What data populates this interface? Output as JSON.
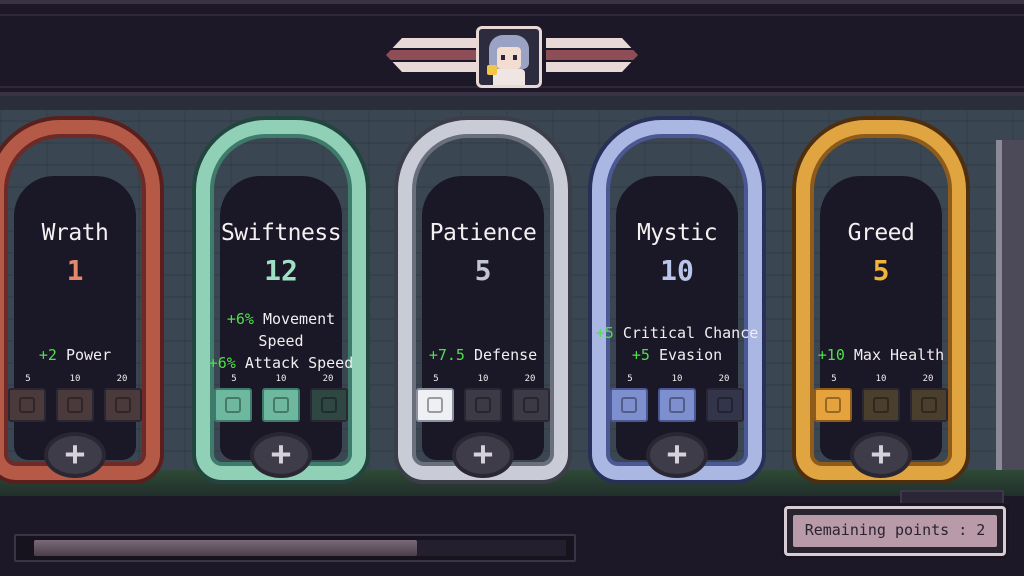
{
  "header": {
    "portrait_icon": "character-portrait-icon"
  },
  "cards": [
    {
      "id": "wrath",
      "title": "Wrath",
      "value": "1",
      "color": "#b65a48",
      "bonus_lines": [
        {
          "amount": "+2",
          "text": "Power"
        }
      ],
      "tiers": [
        "5",
        "10",
        "20"
      ],
      "unlocked_slots": 0
    },
    {
      "id": "swiftness",
      "title": "Swiftness",
      "value": "12",
      "color": "#8fd0b6",
      "bonus_lines": [
        {
          "amount": "+6%",
          "text": "Movement"
        },
        {
          "amount": "",
          "text": "Speed"
        },
        {
          "amount": "+6%",
          "text": "Attack Speed"
        }
      ],
      "tiers": [
        "5",
        "10",
        "20"
      ],
      "unlocked_slots": 2
    },
    {
      "id": "patience",
      "title": "Patience",
      "value": "5",
      "color": "#c9ccd6",
      "bonus_lines": [
        {
          "amount": "+7.5",
          "text": "Defense"
        }
      ],
      "tiers": [
        "5",
        "10",
        "20"
      ],
      "unlocked_slots": 1
    },
    {
      "id": "mystic",
      "title": "Mystic",
      "value": "10",
      "color": "#a9b7e2",
      "bonus_lines": [
        {
          "amount": "+5",
          "text": "Critical Chance"
        },
        {
          "amount": "+5",
          "text": "Evasion"
        }
      ],
      "tiers": [
        "5",
        "10",
        "20"
      ],
      "unlocked_slots": 2
    },
    {
      "id": "greed",
      "title": "Greed",
      "value": "5",
      "color": "#e0a441",
      "bonus_lines": [
        {
          "amount": "+10",
          "text": "Max Health"
        }
      ],
      "tiers": [
        "5",
        "10",
        "20"
      ],
      "unlocked_slots": 1
    }
  ],
  "progress": {
    "fraction": 0.72
  },
  "footer": {
    "remaining_points_label": "Remaining points : 2"
  },
  "colors": {
    "bonus_green": "#4fe04a",
    "background": "#2b2535"
  }
}
